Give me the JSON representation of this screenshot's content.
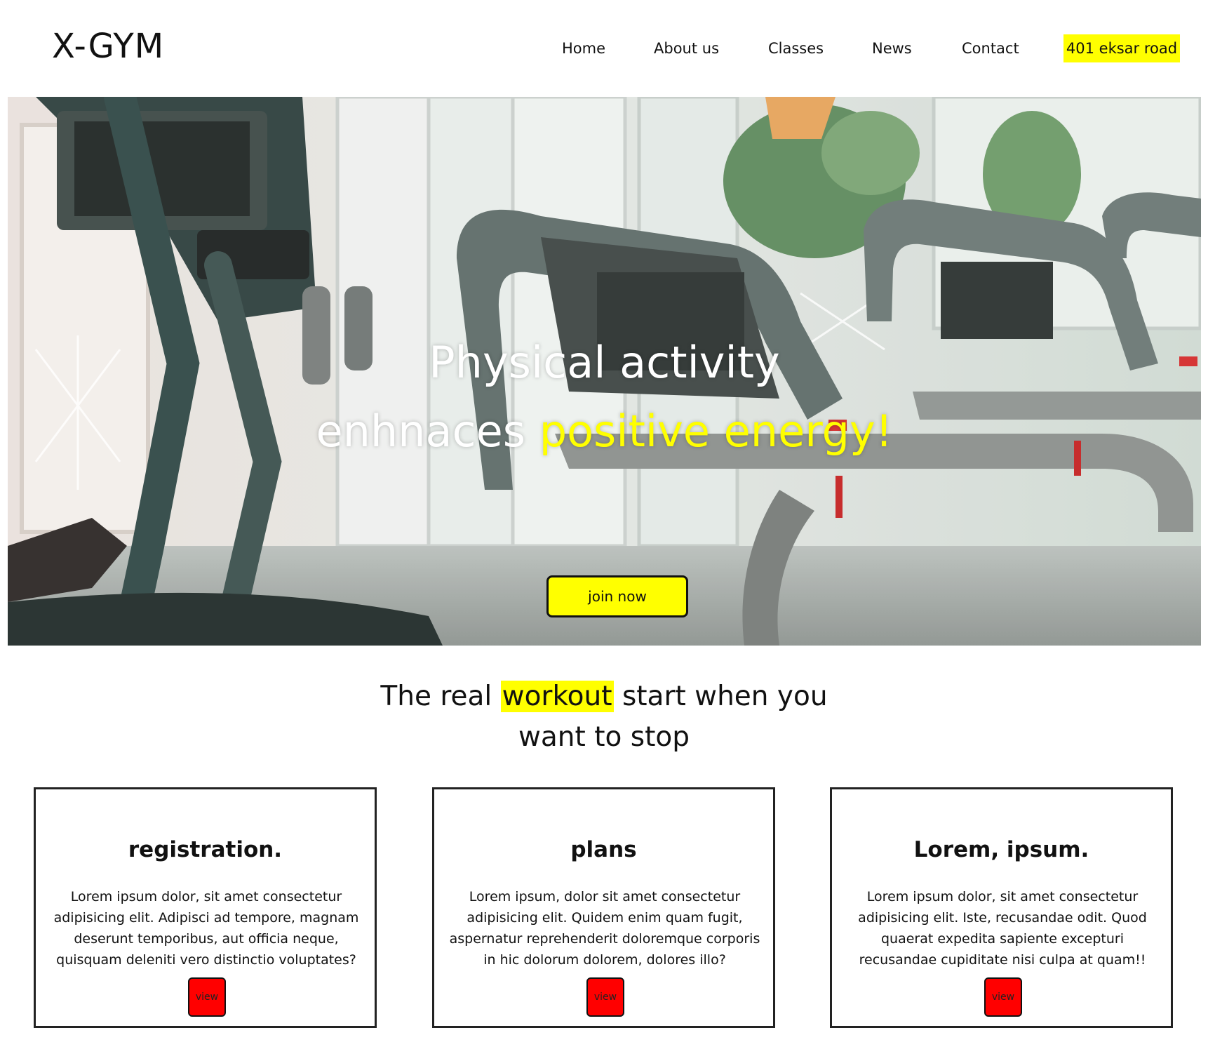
{
  "header": {
    "logo": "X-GYM",
    "nav": [
      "Home",
      "About us",
      "Classes",
      "News",
      "Contact"
    ],
    "address": "401 eksar road"
  },
  "hero": {
    "line1": "Physical activity",
    "line2_a": "enhnaces",
    "line2_b": "positive energy!",
    "join_label": "join now",
    "image_icon": "treadmill-photo"
  },
  "tagline": {
    "part1": "The real",
    "highlight": "workout",
    "part2": "start when you",
    "part3": "want to stop"
  },
  "cards": [
    {
      "title": "registration.",
      "text": "Lorem ipsum dolor, sit amet consectetur adipisicing elit. Adipisci ad tempore, magnam deserunt temporibus, aut officia neque, quisquam deleniti vero distinctio voluptates?",
      "button": "view"
    },
    {
      "title": "plans",
      "text": "Lorem ipsum, dolor sit amet consectetur adipisicing elit. Quidem enim quam fugit, aspernatur reprehenderit doloremque corporis in hic dolorum dolorem, dolores illo?",
      "button": "view"
    },
    {
      "title": "Lorem, ipsum.",
      "text": "Lorem ipsum dolor, sit amet consectetur adipisicing elit. Iste, recusandae odit. Quod quaerat expedita sapiente excepturi recusandae cupiditate nisi culpa at quam!!",
      "button": "view"
    }
  ],
  "colors": {
    "accent": "#ffff00",
    "button_red": "#ff0000",
    "text": "#111111"
  }
}
